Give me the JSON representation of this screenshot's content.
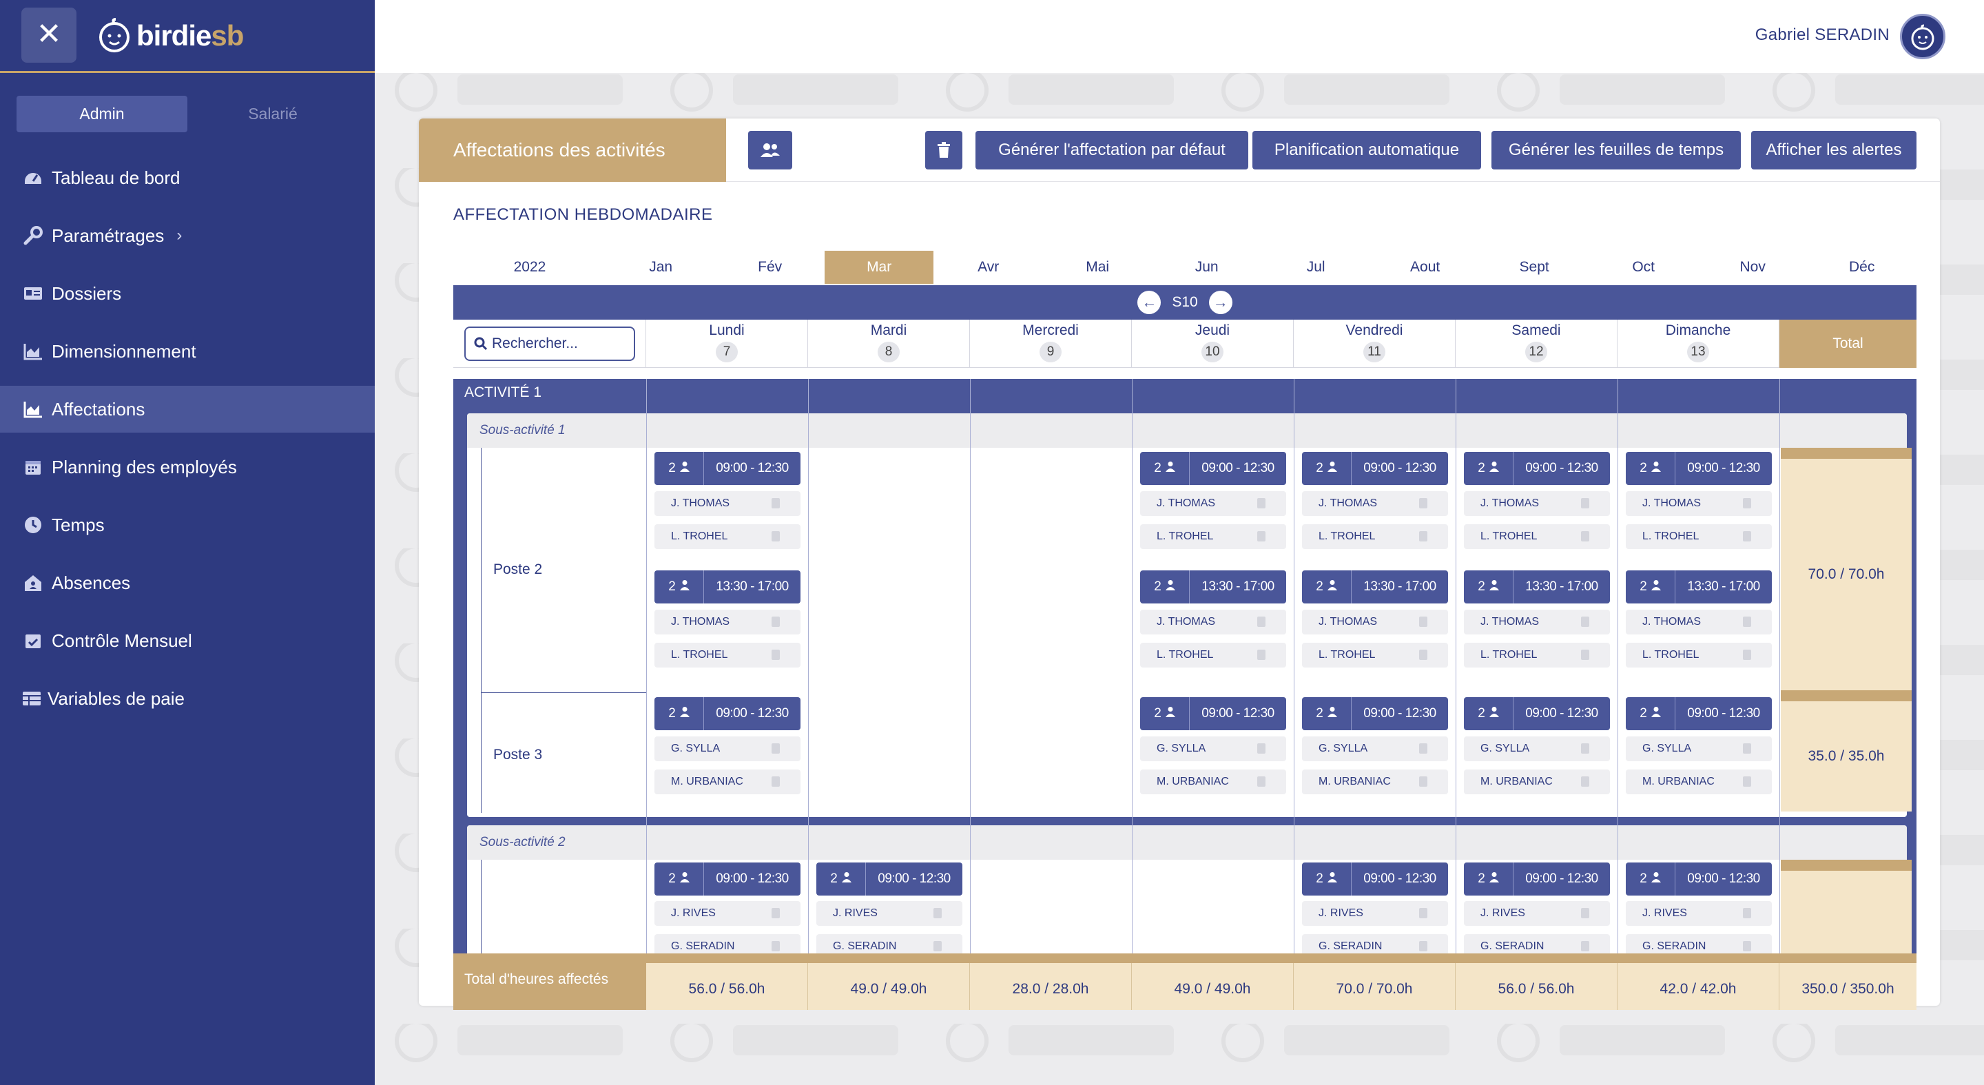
{
  "app": {
    "brand_main": "birdie",
    "brand_accent": "sb",
    "close_icon": "close-icon"
  },
  "colors": {
    "primary": "#2e3a80",
    "accent": "#c8a876",
    "button": "#4a5699",
    "total_bg": "#f4e5c8"
  },
  "sidebar": {
    "roles": [
      {
        "label": "Admin",
        "active": true
      },
      {
        "label": "Salarié",
        "active": false
      }
    ],
    "items": [
      {
        "label": "Tableau de bord",
        "icon": "dashboard-icon"
      },
      {
        "label": "Paramétrages",
        "icon": "wrench-icon"
      },
      {
        "label": "Dossiers",
        "icon": "id-card-icon"
      },
      {
        "label": "Dimensionnement",
        "icon": "area-chart-icon"
      },
      {
        "label": "Affectations",
        "icon": "area-chart-icon",
        "active": true
      },
      {
        "label": "Planning des employés",
        "icon": "calendar-icon"
      },
      {
        "label": "Temps",
        "icon": "clock-icon"
      },
      {
        "label": "Absences",
        "icon": "house-user-icon"
      },
      {
        "label": "Contrôle Mensuel",
        "icon": "calendar-check-icon"
      },
      {
        "label": "Variables de paie",
        "icon": "table-icon"
      }
    ]
  },
  "topbar": {
    "user_name": "Gabriel SERADIN"
  },
  "page": {
    "title": "Affectations des activités",
    "buttons": {
      "default": "Générer l'affectation par défaut",
      "auto": "Planification automatique",
      "timesheets": "Générer les feuilles de temps",
      "alerts": "Afficher les alertes"
    },
    "section_title": "AFFECTATION HEBDOMADAIRE",
    "year": "2022",
    "months": [
      "Jan",
      "Fév",
      "Mar",
      "Avr",
      "Mai",
      "Jun",
      "Jul",
      "Aout",
      "Sept",
      "Oct",
      "Nov",
      "Déc"
    ],
    "active_month": "Mar",
    "week": "S10",
    "search_placeholder": "Rechercher...",
    "days": [
      {
        "name": "Lundi",
        "num": "7"
      },
      {
        "name": "Mardi",
        "num": "8"
      },
      {
        "name": "Mercredi",
        "num": "9"
      },
      {
        "name": "Jeudi",
        "num": "10"
      },
      {
        "name": "Vendredi",
        "num": "11"
      },
      {
        "name": "Samedi",
        "num": "12"
      },
      {
        "name": "Dimanche",
        "num": "13"
      }
    ],
    "total_header": "Total",
    "activity": "ACTIVITÉ 1",
    "sub1": "Sous-activité 1",
    "sub2": "Sous-activité 2",
    "poste2": "Poste 2",
    "poste3": "Poste 3",
    "slot_count": "2",
    "time_morning": "09:00 - 12:30",
    "time_afternoon": "13:30 - 17:00",
    "employees": {
      "thomas": "J. THOMAS",
      "trohel": "L. TROHEL",
      "sylla": "G. SYLLA",
      "urbaniac": "M. URBANIAC",
      "rives": "J. RIVES",
      "seradin": "G. SERADIN"
    },
    "poste2_total": "70.0 / 70.0h",
    "poste3_total": "35.0 / 35.0h",
    "footer_label": "Total d'heures affectés",
    "footer_values": [
      "56.0 / 56.0h",
      "49.0 / 49.0h",
      "28.0 / 28.0h",
      "49.0 / 49.0h",
      "70.0 / 70.0h",
      "56.0 / 56.0h",
      "42.0 / 42.0h"
    ],
    "footer_total": "350.0 / 350.0h"
  }
}
